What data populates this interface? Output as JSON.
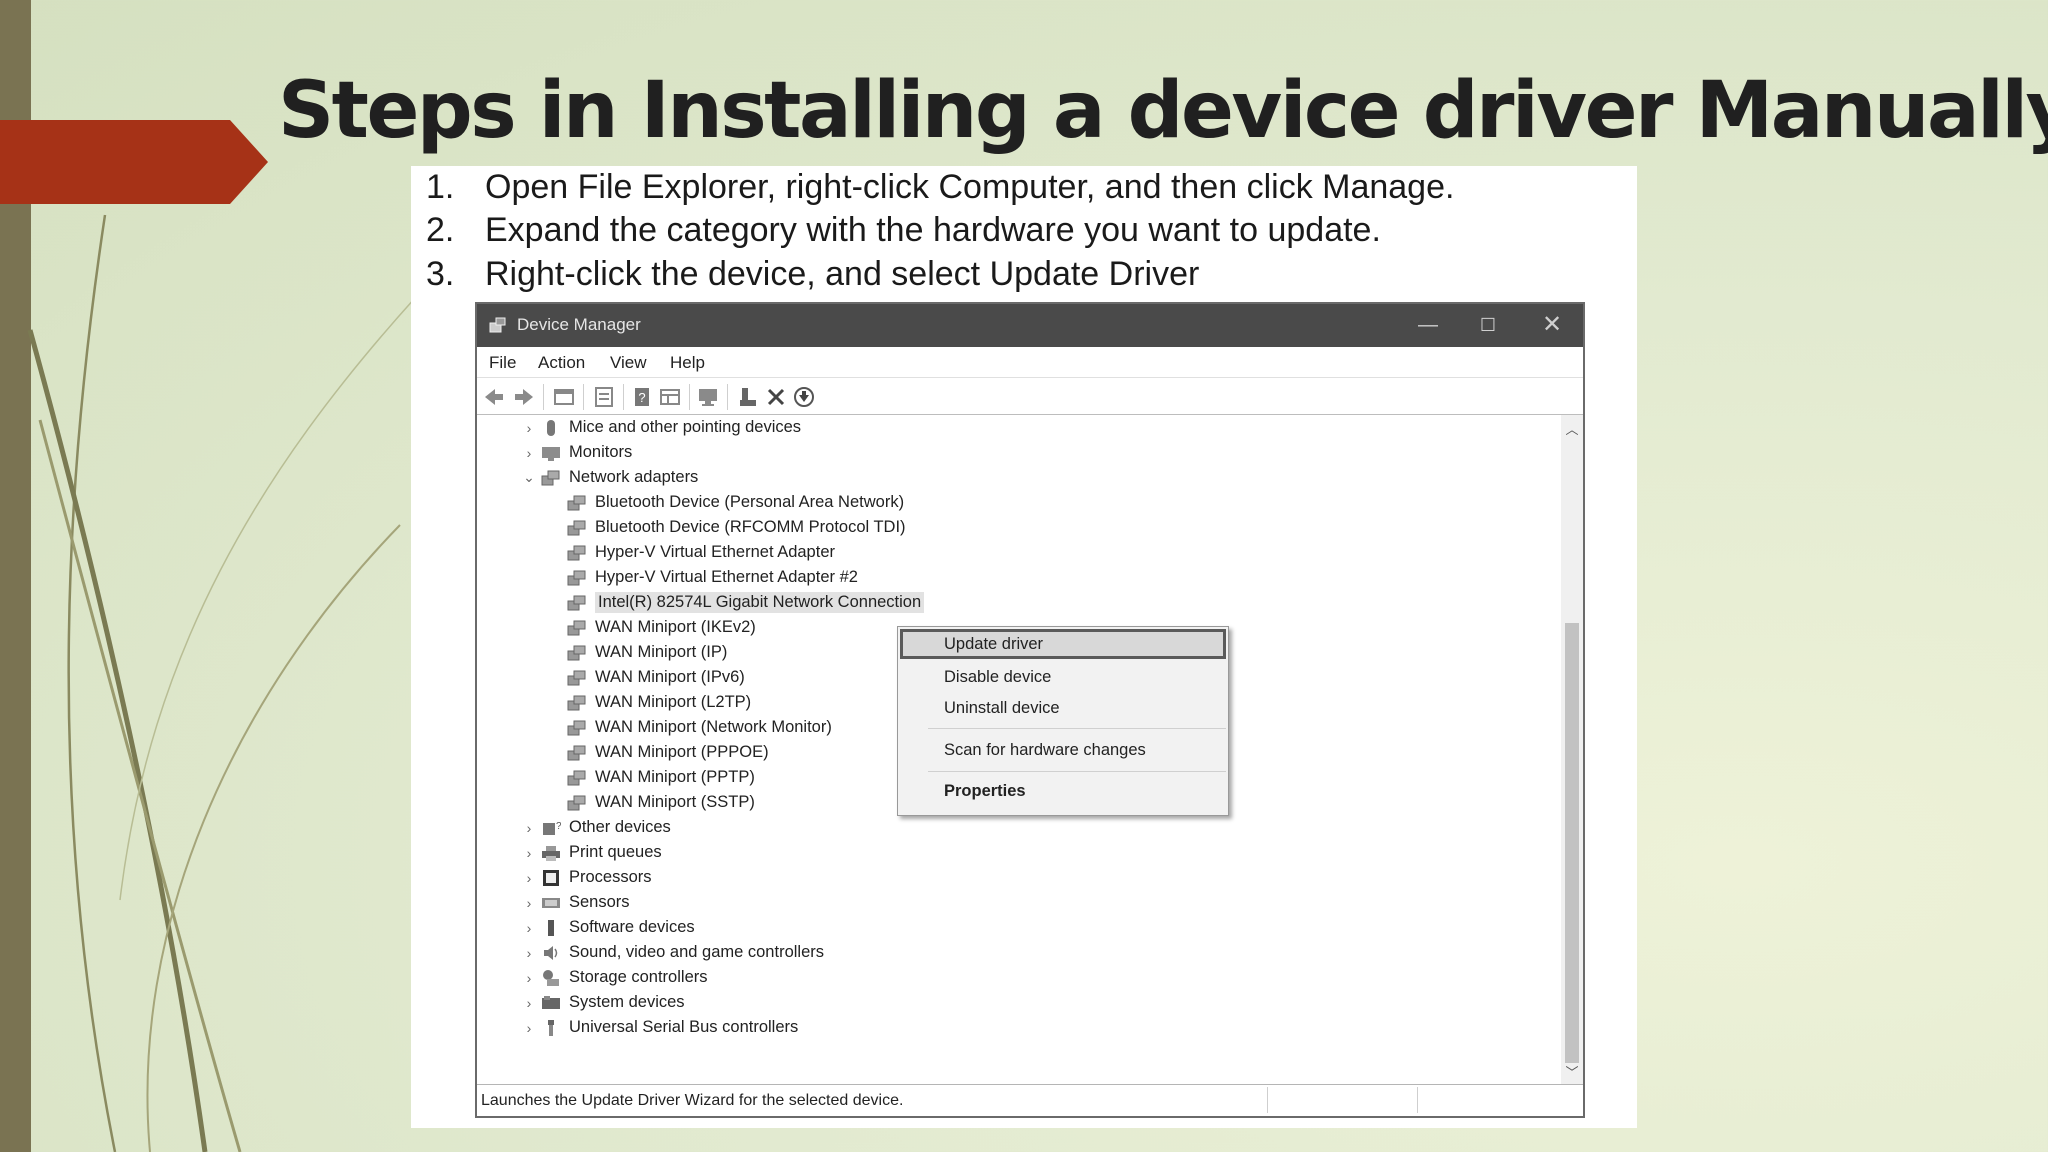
{
  "slide": {
    "title": "Steps in Installing a device driver Manually:",
    "steps": [
      {
        "num": "1.",
        "text": "Open File Explorer, right-click Computer, and then click Manage."
      },
      {
        "num": "2.",
        "text": "Expand the category with the hardware you want to update."
      },
      {
        "num": "3.",
        "text": "Right-click the device, and select Update Driver"
      }
    ]
  },
  "window": {
    "title": "Device Manager",
    "controls": {
      "minimize": "—",
      "maximize": "☐",
      "close": "✕"
    }
  },
  "menubar": {
    "file": "File",
    "action": "Action",
    "view": "View",
    "help": "Help"
  },
  "tree": {
    "collapsed_chevron": "›",
    "expanded_chevron": "⌄",
    "items": [
      {
        "label": "Mice and other pointing devices",
        "icon": "mouse-icon"
      },
      {
        "label": "Monitors",
        "icon": "monitor-icon"
      },
      {
        "label": "Network adapters",
        "icon": "network-icon",
        "expanded": true
      },
      {
        "label": "Bluetooth Device (Personal Area Network)",
        "icon": "network-adapter-icon"
      },
      {
        "label": "Bluetooth Device (RFCOMM Protocol TDI)",
        "icon": "network-adapter-icon"
      },
      {
        "label": "Hyper-V Virtual Ethernet Adapter",
        "icon": "network-adapter-icon"
      },
      {
        "label": "Hyper-V Virtual Ethernet Adapter #2",
        "icon": "network-adapter-icon"
      },
      {
        "label": "Intel(R) 82574L Gigabit Network Connection",
        "icon": "network-adapter-icon",
        "selected": true
      },
      {
        "label": "WAN Miniport (IKEv2)",
        "icon": "network-adapter-icon"
      },
      {
        "label": "WAN Miniport (IP)",
        "icon": "network-adapter-icon"
      },
      {
        "label": "WAN Miniport (IPv6)",
        "icon": "network-adapter-icon"
      },
      {
        "label": "WAN Miniport (L2TP)",
        "icon": "network-adapter-icon"
      },
      {
        "label": "WAN Miniport (Network Monitor)",
        "icon": "network-adapter-icon"
      },
      {
        "label": "WAN Miniport (PPPOE)",
        "icon": "network-adapter-icon"
      },
      {
        "label": "WAN Miniport (PPTP)",
        "icon": "network-adapter-icon"
      },
      {
        "label": "WAN Miniport (SSTP)",
        "icon": "network-adapter-icon"
      },
      {
        "label": "Other devices",
        "icon": "other-devices-icon"
      },
      {
        "label": "Print queues",
        "icon": "printer-icon"
      },
      {
        "label": "Processors",
        "icon": "processor-icon"
      },
      {
        "label": "Sensors",
        "icon": "sensor-icon"
      },
      {
        "label": "Software devices",
        "icon": "software-device-icon"
      },
      {
        "label": "Sound, video and game controllers",
        "icon": "sound-icon"
      },
      {
        "label": "Storage controllers",
        "icon": "storage-icon"
      },
      {
        "label": "System devices",
        "icon": "system-icon"
      },
      {
        "label": "Universal Serial Bus controllers",
        "icon": "usb-icon"
      }
    ]
  },
  "context_menu": {
    "update": "Update driver",
    "disable": "Disable device",
    "uninstall": "Uninstall device",
    "scan": "Scan for hardware changes",
    "properties": "Properties"
  },
  "status": {
    "text": "Launches the Update Driver Wizard for the selected device."
  },
  "colors": {
    "accent_arrow": "#a63217",
    "side_bar": "#7a7352",
    "titlebar": "#4a4a4a"
  }
}
